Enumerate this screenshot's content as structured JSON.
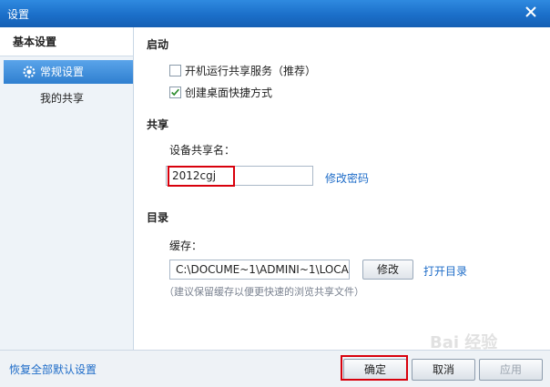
{
  "window": {
    "title": "设置"
  },
  "sidebar": {
    "group": "基本设置",
    "items": [
      {
        "label": "常规设置",
        "selected": true
      },
      {
        "label": "我的共享",
        "selected": false
      }
    ]
  },
  "startup": {
    "heading": "启动",
    "options": [
      {
        "label": "开机运行共享服务（推荐）",
        "checked": false
      },
      {
        "label": "创建桌面快捷方式",
        "checked": true
      }
    ]
  },
  "share": {
    "heading": "共享",
    "name_label": "设备共享名：",
    "name_value": "2012cgj",
    "change_password": "修改密码"
  },
  "directory": {
    "heading": "目录",
    "cache_label": "缓存：",
    "cache_path": "C:\\DOCUME~1\\ADMINI~1\\LOCA",
    "modify": "修改",
    "open_dir": "打开目录",
    "hint": "（建议保留缓存以便更快速的浏览共享文件）"
  },
  "footer": {
    "reset": "恢复全部默认设置",
    "ok": "确定",
    "cancel": "取消",
    "apply": "应用"
  },
  "watermark": "Bai 经验",
  "colors": {
    "titlebar": "#1b6fc9",
    "link": "#1e6cc8",
    "highlight_box": "#d8000c",
    "selected_item": "#2f7fd0"
  }
}
